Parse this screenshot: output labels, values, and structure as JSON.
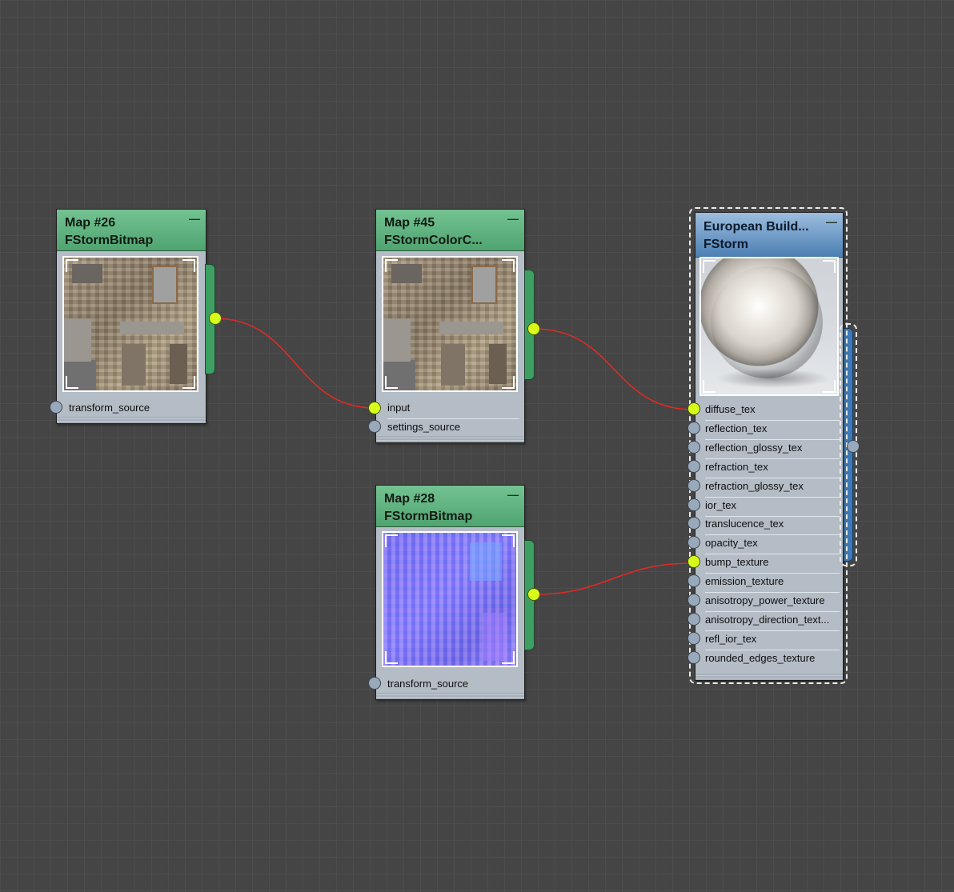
{
  "nodes": {
    "map26": {
      "title": "Map #26",
      "subtitle": "FStormBitmap",
      "thumbnail": "stone-building-texture",
      "slots": [
        "transform_source"
      ]
    },
    "map45": {
      "title": "Map #45",
      "subtitle": "FStormColorC...",
      "thumbnail": "stone-building-texture",
      "slots": [
        "input",
        "settings_source"
      ]
    },
    "map28": {
      "title": "Map #28",
      "subtitle": "FStormBitmap",
      "thumbnail": "normal-map-texture",
      "slots": [
        "transform_source"
      ]
    },
    "material": {
      "title": "European Build...",
      "subtitle": "FStorm",
      "thumbnail": "material-sphere-preview",
      "slots": [
        "diffuse_tex",
        "reflection_tex",
        "reflection_glossy_tex",
        "refraction_tex",
        "refraction_glossy_tex",
        "ior_tex",
        "translucence_tex",
        "opacity_tex",
        "bump_texture",
        "emission_texture",
        "anisotropy_power_texture",
        "anisotropy_direction_text...",
        "refl_ior_tex",
        "rounded_edges_texture"
      ]
    }
  },
  "icons": {
    "minimize": "minimize-icon"
  },
  "colors": {
    "background": "#454545",
    "map_header": "#5bb57c",
    "material_header": "#6a9bcc",
    "wire": "#e02a24",
    "connected_port": "#d8ff1a",
    "idle_port": "#98a9bc"
  },
  "connections": [
    {
      "from": "Map #26",
      "to": "Map #45.input"
    },
    {
      "from": "Map #45",
      "to": "European Build....diffuse_tex"
    },
    {
      "from": "Map #28",
      "to": "European Build....bump_texture"
    }
  ]
}
